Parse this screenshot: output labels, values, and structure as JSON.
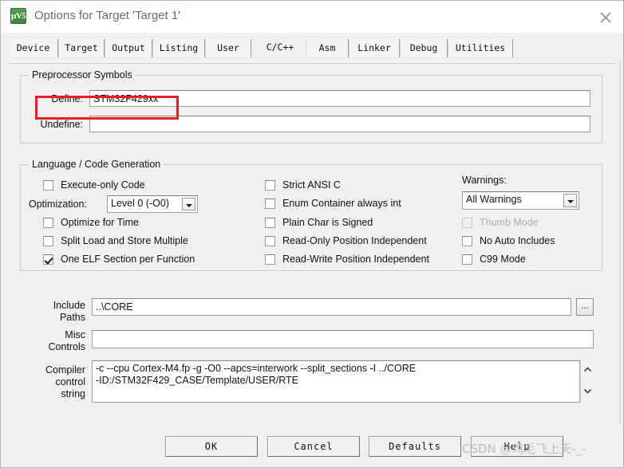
{
  "window": {
    "title": "Options for Target 'Target 1'",
    "app_icon": "uvision-icon",
    "app_icon_glyph": "µV5",
    "close_label": "close-icon"
  },
  "tabs": [
    {
      "label": "Device",
      "selected": false
    },
    {
      "label": "Target",
      "selected": false
    },
    {
      "label": "Output",
      "selected": false
    },
    {
      "label": "Listing",
      "selected": false
    },
    {
      "label": "User",
      "selected": false
    },
    {
      "label": "C/C++",
      "selected": true
    },
    {
      "label": "Asm",
      "selected": false
    },
    {
      "label": "Linker",
      "selected": false
    },
    {
      "label": "Debug",
      "selected": false
    },
    {
      "label": "Utilities",
      "selected": false
    }
  ],
  "preprocessor": {
    "legend": "Preprocessor Symbols",
    "define_label": "Define:",
    "define_value": "STM32F429xx",
    "define_placeholder": "",
    "undefine_label": "Undefine:",
    "undefine_value": "",
    "undefine_placeholder": ""
  },
  "language": {
    "legend": "Language / Code Generation",
    "left_options": [
      {
        "label": "Execute-only Code",
        "checked": false,
        "disabled": false
      },
      {
        "label": "Optimize for Time",
        "checked": false,
        "disabled": false
      },
      {
        "label": "Split Load and Store Multiple",
        "checked": false,
        "disabled": false
      },
      {
        "label": "One ELF Section per Function",
        "checked": true,
        "disabled": false
      }
    ],
    "optimization_label": "Optimization:",
    "optimization_value": "Level 0 (-O0)",
    "middle_options": [
      {
        "label": "Strict ANSI C",
        "checked": false,
        "disabled": false
      },
      {
        "label": "Enum Container always int",
        "checked": false,
        "disabled": false
      },
      {
        "label": "Plain Char is Signed",
        "checked": false,
        "disabled": false
      },
      {
        "label": "Read-Only Position Independent",
        "checked": false,
        "disabled": false
      },
      {
        "label": "Read-Write Position Independent",
        "checked": false,
        "disabled": false
      }
    ],
    "warnings_label": "Warnings:",
    "warnings_value": "All Warnings",
    "right_options": [
      {
        "label": "Thumb Mode",
        "checked": false,
        "disabled": true
      },
      {
        "label": "No Auto Includes",
        "checked": false,
        "disabled": false
      },
      {
        "label": "C99 Mode",
        "checked": false,
        "disabled": false
      }
    ]
  },
  "paths": {
    "include_label_line1": "Include",
    "include_label_line2": "Paths",
    "include_value": "..\\CORE",
    "browse_label": "...",
    "misc_label_line1": "Misc",
    "misc_label_line2": "Controls",
    "misc_value": "",
    "compiler_label_line1": "Compiler",
    "compiler_label_line2": "control",
    "compiler_label_line3": "string",
    "compiler_value": "-c --cpu Cortex-M4.fp -g -O0 --apcs=interwork --split_sections -I ../CORE\n-ID:/STM32F429_CASE/Template/USER/RTE"
  },
  "footer": {
    "ok_label": "OK",
    "cancel_label": "Cancel",
    "defaults_label": "Defaults",
    "help_label": "Help"
  },
  "annotations": {
    "highlight_color": "#ec1c24",
    "tab_highlight": "C/C++",
    "define_highlight": "Define: STM32F429xx"
  },
  "watermark": {
    "text": "CSDN @鸡毛飞上天-_-"
  }
}
